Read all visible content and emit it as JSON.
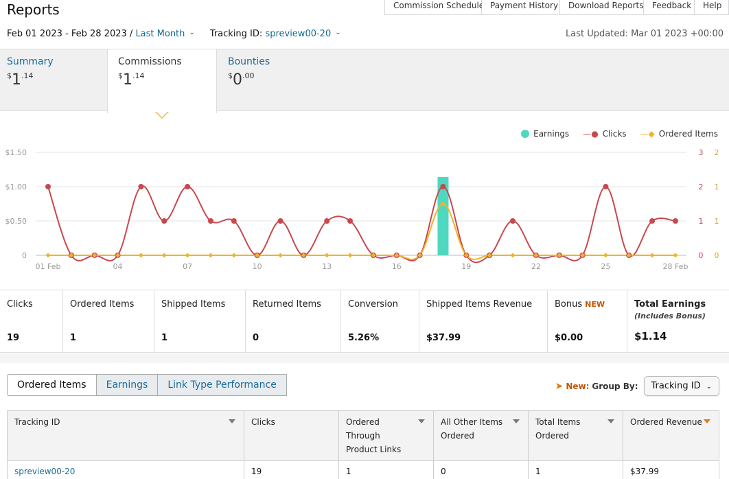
{
  "page": {
    "title": "Reports",
    "top_links": [
      "Commission Schedule",
      "Payment History",
      "Download Reports",
      "Feedback",
      "Help"
    ],
    "date_range": "Feb 01 2023 - Feb 28 2023",
    "date_preset": "Last Month",
    "tracking_label": "Tracking ID:",
    "tracking_value": "spreview00-20",
    "last_updated": "Last Updated: Mar 01 2023 +00:00"
  },
  "summary_tabs": [
    {
      "label": "Summary",
      "currency": "$",
      "whole": "1",
      "cents": ".14"
    },
    {
      "label": "Commissions",
      "currency": "$",
      "whole": "1",
      "cents": ".14"
    },
    {
      "label": "Bounties",
      "currency": "$",
      "whole": "0",
      "cents": ".00"
    }
  ],
  "legend": [
    {
      "label": "Earnings",
      "color": "#4fd8c0"
    },
    {
      "label": "Clicks",
      "color": "#c8484e"
    },
    {
      "label": "Ordered Items",
      "color": "#f0b429"
    }
  ],
  "chart_data": {
    "type": "line",
    "x": [
      "01 Feb",
      "02",
      "03",
      "04",
      "05",
      "06",
      "07",
      "08",
      "09",
      "10",
      "11",
      "12",
      "13",
      "14",
      "15",
      "16",
      "17",
      "18",
      "19",
      "20",
      "21",
      "22",
      "23",
      "24",
      "25",
      "26",
      "27",
      "28 Feb"
    ],
    "x_tick_labels": [
      "01 Feb",
      "04",
      "07",
      "10",
      "13",
      "16",
      "19",
      "22",
      "25",
      "28 Feb"
    ],
    "y_left_ticks": [
      "$1.50",
      "$1.00",
      "$0.50",
      "0"
    ],
    "y_left_range": [
      0,
      1.5
    ],
    "y_right1_ticks": [
      "3",
      "2",
      "1",
      "0"
    ],
    "y_right1_range": [
      0,
      3
    ],
    "y_right2_ticks": [
      "2",
      "1",
      "1",
      "0"
    ],
    "y_right2_range": [
      0,
      2
    ],
    "series": [
      {
        "name": "Earnings",
        "type": "bar",
        "axis": "left",
        "color": "#4fd8c0",
        "values": [
          0,
          0,
          0,
          0,
          0,
          0,
          0,
          0,
          0,
          0,
          0,
          0,
          0,
          0,
          0,
          0,
          0,
          1.14,
          0,
          0,
          0,
          0,
          0,
          0,
          0,
          0,
          0,
          0
        ]
      },
      {
        "name": "Clicks",
        "type": "line",
        "axis": "right1",
        "color": "#c8484e",
        "values": [
          2,
          0,
          0,
          0,
          2,
          1,
          2,
          1,
          1,
          0,
          1,
          0,
          1,
          1,
          0,
          0,
          0,
          2,
          0,
          0,
          1,
          0,
          0,
          0,
          2,
          0,
          1,
          1
        ]
      },
      {
        "name": "Ordered Items",
        "type": "line",
        "axis": "right2",
        "color": "#f0b429",
        "values": [
          0,
          0,
          0,
          0,
          0,
          0,
          0,
          0,
          0,
          0,
          0,
          0,
          0,
          0,
          0,
          0,
          0,
          1,
          0,
          0,
          0,
          0,
          0,
          0,
          0,
          0,
          0,
          0
        ]
      }
    ],
    "grid": true,
    "legend_position": "top-right"
  },
  "stats": [
    {
      "label": "Clicks",
      "value": "19"
    },
    {
      "label": "Ordered Items",
      "value": "1"
    },
    {
      "label": "Shipped Items",
      "value": "1"
    },
    {
      "label": "Returned Items",
      "value": "0"
    },
    {
      "label": "Conversion",
      "value": "5.26%"
    },
    {
      "label": "Shipped Items Revenue",
      "value": "$37.99"
    },
    {
      "label": "Bonus",
      "badge": "NEW",
      "value": "$0.00"
    },
    {
      "label": "Total Earnings",
      "sub": "(Includes Bonus)",
      "value": "$1.14"
    }
  ],
  "bottom_tabs": [
    "Ordered Items",
    "Earnings",
    "Link Type Performance"
  ],
  "group_by": {
    "new_label": "New:",
    "label": "Group By:",
    "value": "Tracking ID"
  },
  "table": {
    "headers": [
      "Tracking ID",
      "Clicks",
      "Ordered Through Product Links",
      "All Other Items Ordered",
      "Total Items Ordered",
      "Ordered Revenue"
    ],
    "rows": [
      [
        "spreview00-20",
        "19",
        "1",
        "0",
        "1",
        "$37.99"
      ]
    ]
  }
}
